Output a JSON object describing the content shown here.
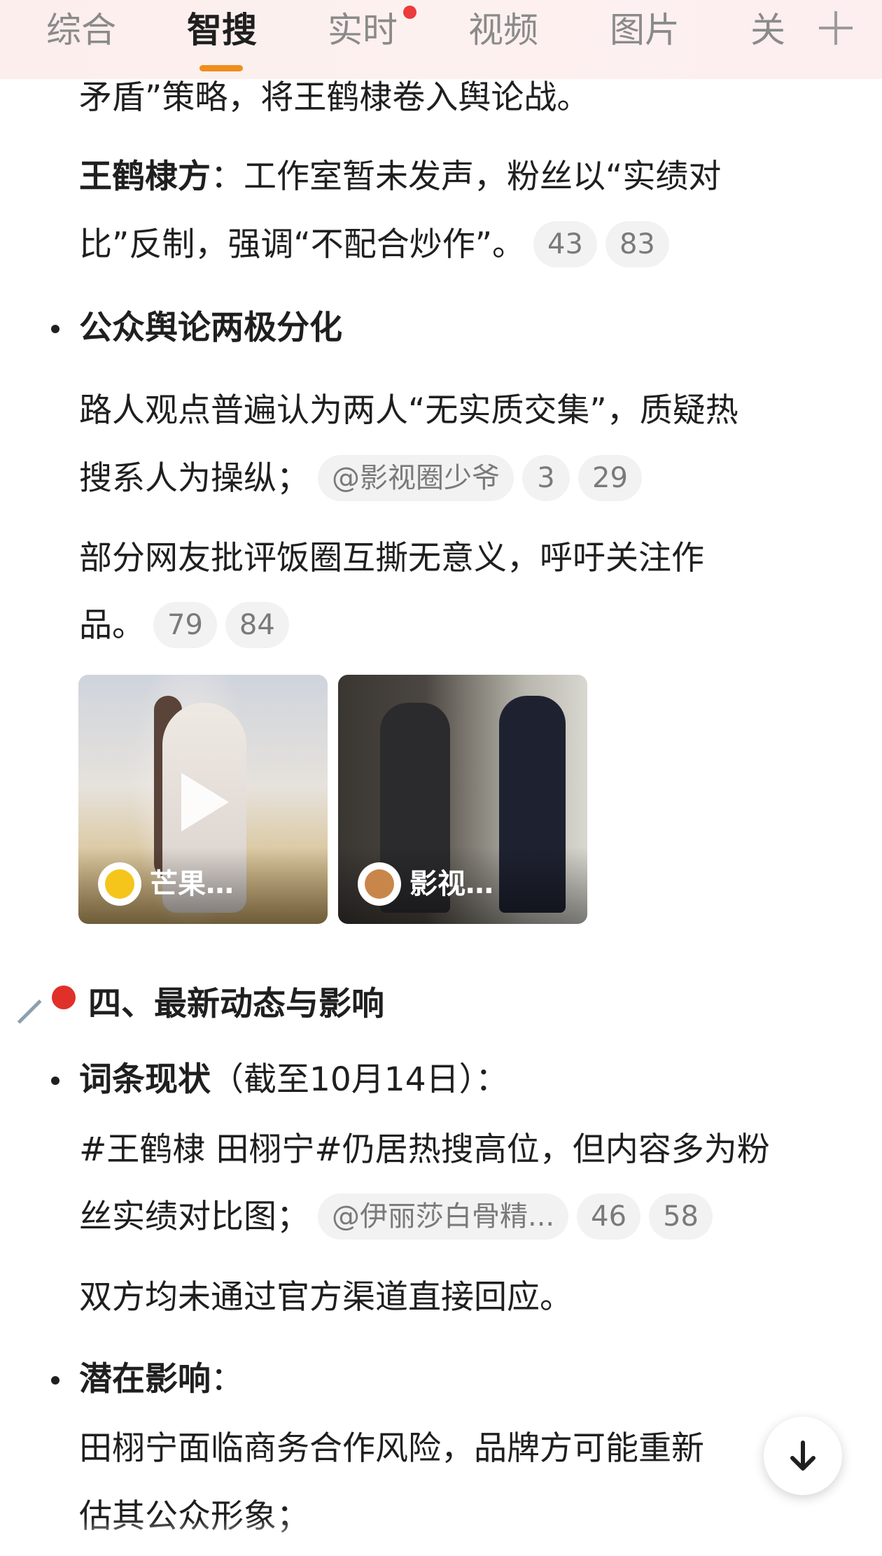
{
  "tabs": [
    {
      "label": "综合"
    },
    {
      "label": "智搜"
    },
    {
      "label": "实时"
    },
    {
      "label": "视频"
    },
    {
      "label": "图片"
    },
    {
      "label": "关"
    }
  ],
  "active_tab": "智搜",
  "colors": {
    "accent": "#f08d1d",
    "notice_dot": "#eb3b3b",
    "chip_bg": "#f2f2f2"
  },
  "content": {
    "line1": "矛盾”策略，将王鹤棣卷入舆论战。",
    "wang_label": "王鹤棣方",
    "wang_text": "：工作室暂未发声，粉丝以“实绩对",
    "wang_text2": "比”反制，强调“不配合炒作”。",
    "chip_a1": "43",
    "chip_a2": "83",
    "bullet1_title": "公众舆论两极分化",
    "p1_line1": "路人观点普遍认为两人“无实质交集”，质疑热",
    "p1_line2": "搜系人为操纵；",
    "chip_b_src": "@影视圈少爷",
    "chip_b1": "3",
    "chip_b2": "29",
    "p2_line1": "部分网友批评饭圈互撕无意义，呼吁关注作",
    "p2_line2": "品。",
    "chip_c1": "79",
    "chip_c2": "84",
    "media": [
      {
        "label": "芒果…",
        "icon": "play-icon"
      },
      {
        "label": "影视…"
      }
    ],
    "section_title": "四、最新动态与影响",
    "bullet2_title": "词条现状",
    "bullet2_suffix": "（截至10月14日）：",
    "p3_line1": "#王鹤棣 田栩宁#仍居热搜高位，但内容多为粉",
    "p3_line2": "丝实绩对比图；",
    "chip_d_src": "@伊丽莎白骨精...",
    "chip_d1": "46",
    "chip_d2": "58",
    "p4_line1": "双方均未通过官方渠道直接回应。",
    "bullet3_title": "潜在影响",
    "bullet3_suffix": "：",
    "p5_line1": "田栩宁面临商务合作风险，品牌方可能重新",
    "p5_line2": "估其公众形象；"
  }
}
